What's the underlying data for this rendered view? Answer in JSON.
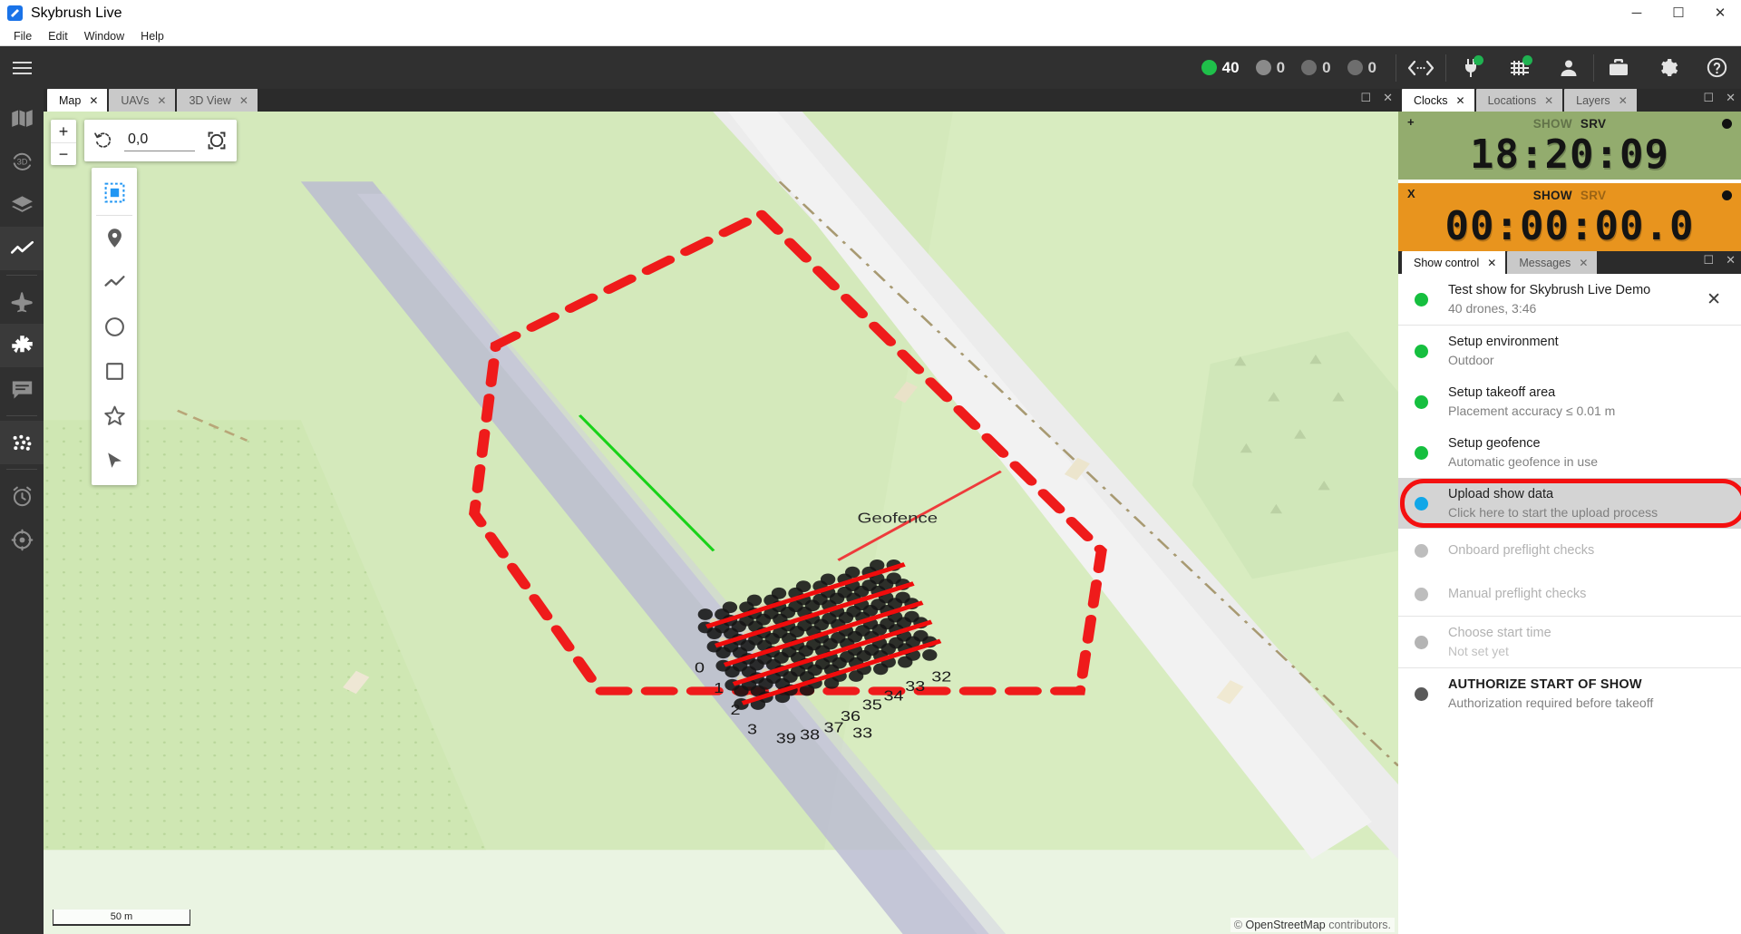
{
  "window": {
    "title": "Skybrush Live",
    "minimize": "─",
    "maximize": "☐",
    "close": "✕"
  },
  "menu": [
    "File",
    "Edit",
    "Window",
    "Help"
  ],
  "toolbar": {
    "hamburger_name": "main-menu",
    "counters": [
      {
        "label": "40",
        "color": "#1fc04a",
        "state": "ok"
      },
      {
        "label": "0",
        "color": "#8a8a8a",
        "state": "warning"
      },
      {
        "label": "0",
        "color": "#6e6e6e",
        "state": "error"
      },
      {
        "label": "0",
        "color": "#6e6e6e",
        "state": "offline"
      }
    ],
    "buttons": [
      {
        "icon": "network-spread-icon",
        "badge": null
      },
      {
        "icon": "plug-connection-icon",
        "badge": "#1fb251"
      },
      {
        "icon": "geofence-grid-icon",
        "badge": "#1fb251"
      },
      {
        "icon": "person-icon",
        "badge": null
      },
      {
        "icon": "toolbox-icon",
        "badge": null
      },
      {
        "icon": "gear-icon",
        "badge": null
      },
      {
        "icon": "help-icon",
        "badge": null
      }
    ]
  },
  "rail": [
    {
      "icon": "map-icon",
      "selected": false
    },
    {
      "icon": "3d-view-icon",
      "selected": false
    },
    {
      "icon": "layers-icon",
      "selected": false
    },
    {
      "icon": "chart-icon",
      "selected": true
    },
    {
      "icon": "airplane-icon",
      "selected": false
    },
    {
      "icon": "uav-icon",
      "selected": true
    },
    {
      "icon": "messages-icon",
      "selected": false
    },
    {
      "icon": "show-dots-icon",
      "selected": true
    },
    {
      "icon": "clock-icon",
      "selected": false
    },
    {
      "icon": "locate-icon",
      "selected": false
    }
  ],
  "center_panel": {
    "tabs": [
      {
        "label": "Map",
        "active": true
      },
      {
        "label": "UAVs",
        "active": false
      },
      {
        "label": "3D View",
        "active": false
      }
    ],
    "maximize": "☐",
    "close": "✕"
  },
  "map": {
    "zoom_in": "+",
    "zoom_out": "−",
    "rotation_value": "0,0",
    "rotation_reset_icon": "rotate-reset-icon",
    "fit_icon": "fit-to-screen-icon",
    "tools": [
      {
        "icon": "select-box-tool",
        "selected": true
      },
      {
        "icon": "marker-pin-tool",
        "selected": false
      },
      {
        "icon": "polyline-tool",
        "selected": false
      },
      {
        "icon": "circle-tool",
        "selected": false
      },
      {
        "icon": "rectangle-tool",
        "selected": false
      },
      {
        "icon": "star-polygon-tool",
        "selected": false
      },
      {
        "icon": "cursor-arrow-tool",
        "selected": false
      }
    ],
    "geofence_label": "Geofence",
    "scale_label": "50 m",
    "attribution_prefix": "© ",
    "attribution_link": "OpenStreetMap",
    "attribution_suffix": " contributors.",
    "drone_labels": [
      "0",
      "1",
      "2",
      "3",
      "39",
      "38",
      "37",
      "36",
      "35",
      "34",
      "33",
      "32",
      "33"
    ]
  },
  "right_panel": {
    "clocks_tabs": [
      {
        "label": "Clocks",
        "active": true
      },
      {
        "label": "Locations",
        "active": false
      },
      {
        "label": "Layers",
        "active": false
      }
    ],
    "maximize": "☐",
    "close": "✕",
    "clocks": [
      {
        "flag": "+",
        "label_primary": "SHOW",
        "label_secondary": "SRV",
        "primary_on": false,
        "secondary_on": true,
        "digits": "18:20:09",
        "color": "#93ac6e"
      },
      {
        "flag": "X",
        "label_primary": "SHOW",
        "label_secondary": "SRV",
        "primary_on": true,
        "secondary_on": false,
        "digits": "00:00:00.0",
        "color": "#e8941e"
      }
    ],
    "showctl_tabs": [
      {
        "label": "Show control",
        "active": true
      },
      {
        "label": "Messages",
        "active": false
      }
    ],
    "show_steps": [
      {
        "title": "Test show for Skybrush Live Demo",
        "subtitle": "40 drones, 3:46",
        "bullet": "#16bf3f",
        "state": "done",
        "has_close": true,
        "divider_after": true,
        "highlight": false
      },
      {
        "title": "Setup environment",
        "subtitle": "Outdoor",
        "bullet": "#16bf3f",
        "state": "done",
        "has_close": false,
        "divider_after": false,
        "highlight": false
      },
      {
        "title": "Setup takeoff area",
        "subtitle": "Placement accuracy ≤ 0.01 m",
        "bullet": "#16bf3f",
        "state": "done",
        "has_close": false,
        "divider_after": false,
        "highlight": false
      },
      {
        "title": "Setup geofence",
        "subtitle": "Automatic geofence in use",
        "bullet": "#16bf3f",
        "state": "done",
        "has_close": false,
        "divider_after": false,
        "highlight": false
      },
      {
        "title": "Upload show data",
        "subtitle": "Click here to start the upload process",
        "bullet": "#11a7e8",
        "state": "next",
        "has_close": false,
        "divider_after": false,
        "highlight": true
      },
      {
        "title": "Onboard preflight checks",
        "subtitle": "",
        "bullet": "#bdbdbd",
        "state": "disabled",
        "has_close": false,
        "divider_after": false,
        "highlight": false
      },
      {
        "title": "Manual preflight checks",
        "subtitle": "",
        "bullet": "#bdbdbd",
        "state": "disabled",
        "has_close": false,
        "divider_after": true,
        "highlight": false
      },
      {
        "title": "Choose start time",
        "subtitle": "Not set yet",
        "bullet": "#b4b4b4",
        "state": "disabled",
        "has_close": false,
        "divider_after": true,
        "highlight": false
      },
      {
        "title": "AUTHORIZE START OF SHOW",
        "subtitle": "Authorization required before takeoff",
        "bullet": "#5a5a5a",
        "state": "bold",
        "has_close": false,
        "divider_after": false,
        "highlight": false
      }
    ]
  }
}
